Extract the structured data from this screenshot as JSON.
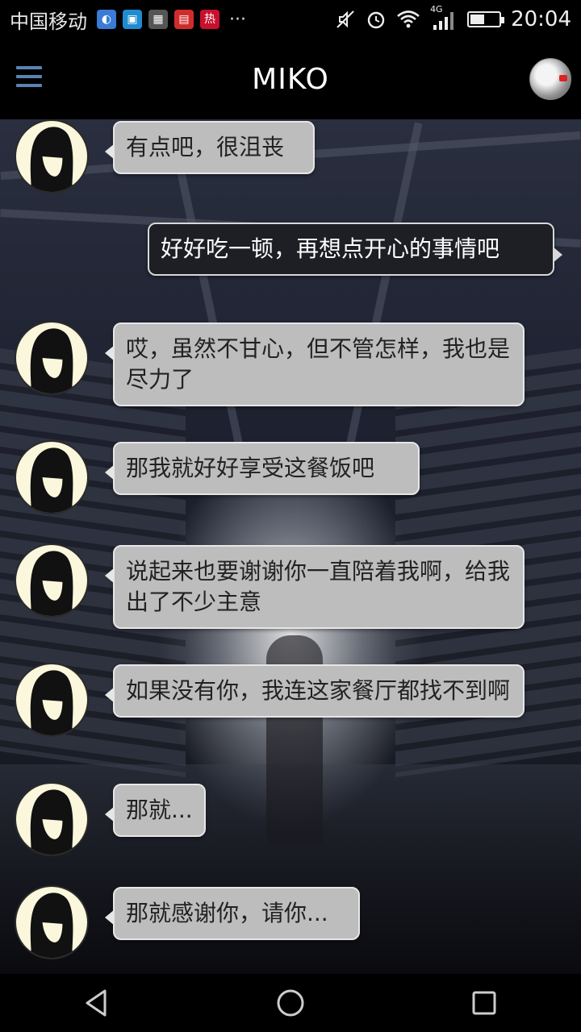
{
  "status_bar": {
    "carrier": "中国移动",
    "notifications": [
      {
        "icon": "browser-icon",
        "color": "#3a7bd5"
      },
      {
        "icon": "app-icon",
        "color": "#1f8bd1"
      },
      {
        "icon": "photo-icon",
        "color": "#555555"
      },
      {
        "icon": "news-icon",
        "color": "#d22b2b"
      },
      {
        "icon": "hot-icon",
        "color": "#c8102e",
        "label": "热"
      }
    ],
    "more": "···",
    "network": "4G",
    "time": "20:04",
    "battery_level": 0.45
  },
  "app_bar": {
    "title": "MIKO"
  },
  "messages": [
    {
      "side": "in",
      "text": "有点吧，很沮丧"
    },
    {
      "side": "out",
      "text": "好好吃一顿，再想点开心的事情吧"
    },
    {
      "side": "in",
      "text": "哎，虽然不甘心，但不管怎样，我也是尽力了"
    },
    {
      "side": "in",
      "text": "那我就好好享受这餐饭吧"
    },
    {
      "side": "in",
      "text": "说起来也要谢谢你一直陪着我啊，给我出了不少主意"
    },
    {
      "side": "in",
      "text": "如果没有你，我连这家餐厅都找不到啊"
    },
    {
      "side": "in",
      "text": "那就..."
    },
    {
      "side": "in",
      "text": "那就感谢你，请你..."
    }
  ],
  "colors": {
    "incoming_bubble": "#bdbdbd",
    "outgoing_bubble": "#1e1f24",
    "menu_accent": "#5b82b3"
  }
}
